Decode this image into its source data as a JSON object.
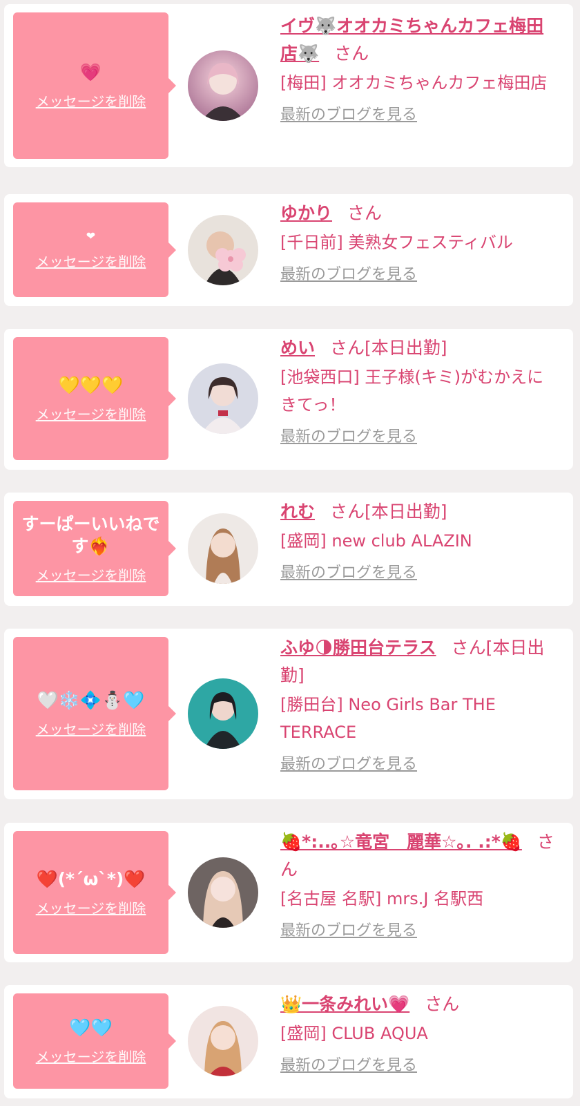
{
  "common": {
    "delete_label": "メッセージを削除",
    "blog_label": "最新のブログを見る",
    "honorific": "さん"
  },
  "entries": [
    {
      "message": "💗",
      "name": "イヴ🐺オオカミちゃんカフェ梅田店🐺",
      "status": "",
      "shop": "[梅田] オオカミちゃんカフェ梅田店"
    },
    {
      "message": "❤",
      "name": "ゆかり",
      "status": "",
      "shop": "[千日前] 美熟女フェスティバル"
    },
    {
      "message": "💛💛💛",
      "name": "めい",
      "status": "[本日出勤]",
      "shop": "[池袋西口] 王子様(キミ)がむかえにきてっ！"
    },
    {
      "message": "すーぱーいいねです❤️‍🔥",
      "name": "れむ",
      "status": "[本日出勤]",
      "shop": "[盛岡] new club ALAZIN"
    },
    {
      "message": "🤍❄️💠⛄️🩵",
      "name": "ふゆ🌗勝田台テラス",
      "status": "[本日出勤]",
      "shop": "[勝田台] Neo Girls Bar THE TERRACE"
    },
    {
      "message": "❤️(*´ω`*)❤️",
      "name": "🍓*:..｡☆竜宮　麗華☆｡. .:*🍓",
      "status": "",
      "shop": "[名古屋 名駅] mrs.J 名駅西"
    },
    {
      "message": "🩵🩵",
      "name": "👑一条みれい💗",
      "status": "",
      "shop": "[盛岡] CLUB AQUA"
    }
  ]
}
